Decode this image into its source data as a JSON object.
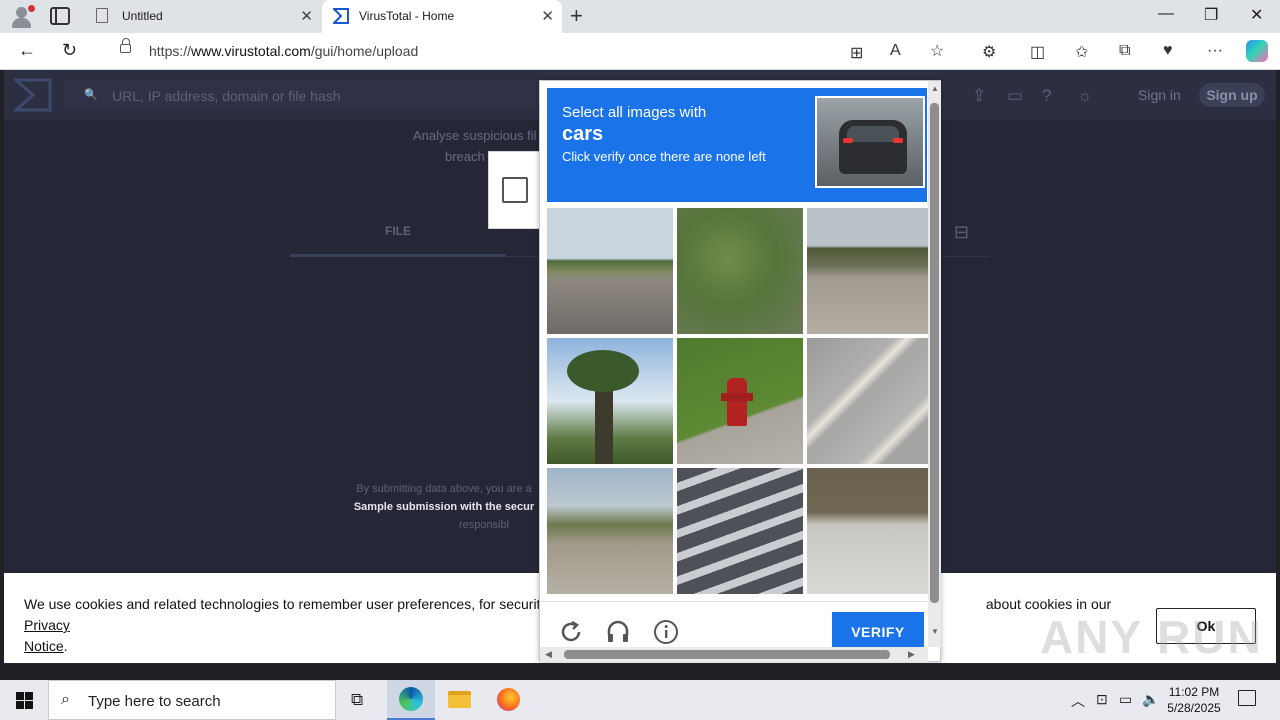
{
  "browser": {
    "tabs": [
      {
        "title": "Untitled",
        "active": false
      },
      {
        "title": "VirusTotal - Home",
        "active": true
      }
    ],
    "url_prefix": "https://",
    "url_domain": "www.virustotal.com",
    "url_path": "/gui/home/upload"
  },
  "virustotal": {
    "search_placeholder": "URL, IP address, domain or file hash",
    "sign_in": "Sign in",
    "sign_up": "Sign up",
    "tagline_line1": "Analyse suspicious fil",
    "tagline_line2": "breach",
    "tab_file": "FILE",
    "terms_line1": "By submitting data above, you are a",
    "terms_line2": "Sample submission with the secur",
    "terms_line3": "responsibl"
  },
  "captcha": {
    "instruction_line1": "Select all images with",
    "target": "cars",
    "instruction_line3": "Click verify once there are none left",
    "verify_label": "VERIFY",
    "tiles": [
      {
        "name": "road-palms"
      },
      {
        "name": "grass"
      },
      {
        "name": "bridge-road"
      },
      {
        "name": "palm-tree"
      },
      {
        "name": "fire-hydrant"
      },
      {
        "name": "road-lines"
      },
      {
        "name": "highway"
      },
      {
        "name": "crosswalk"
      },
      {
        "name": "sidewalk"
      }
    ]
  },
  "cookie": {
    "text_before": "We use cookies and related technologies to remember user preferences, for security, to",
    "text_after": "about cookies in our",
    "link1": "Privacy",
    "link2": "Notice",
    "period": ".",
    "ok_label": "Ok"
  },
  "watermark": "ANY RUN",
  "taskbar": {
    "search_placeholder": "Type here to search",
    "time": "11:02 PM",
    "date": "5/28/2025"
  }
}
